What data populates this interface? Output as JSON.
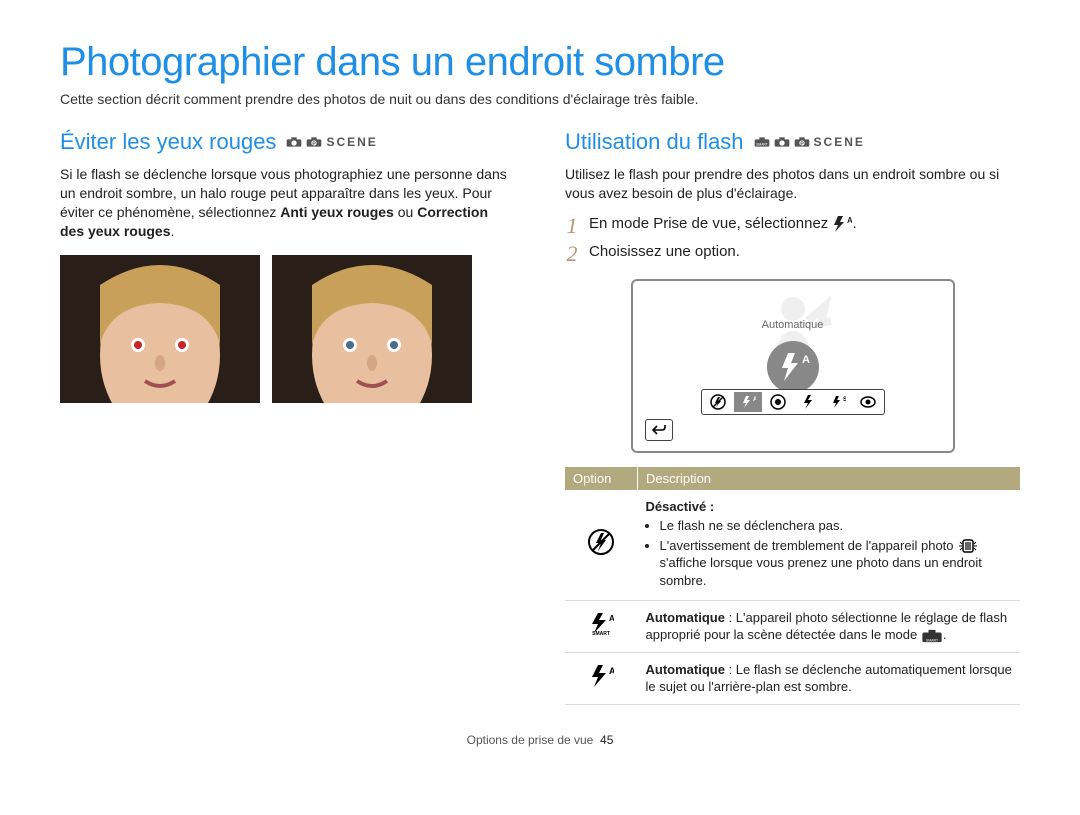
{
  "title": "Photographier dans un endroit sombre",
  "intro": "Cette section décrit comment prendre des photos de nuit ou dans des conditions d'éclairage très faible.",
  "left": {
    "heading": "Éviter les yeux rouges",
    "body_plain": "Si le flash se déclenche lorsque vous photographiez une personne dans un endroit sombre, un halo rouge peut apparaître dans les yeux. Pour éviter ce phénomène, sélectionnez ",
    "body_bold": "Anti yeux rouges",
    "body_join": " ou ",
    "body_bold2": "Correction des yeux rouges",
    "body_end": "."
  },
  "right": {
    "heading": "Utilisation du flash",
    "body": "Utilisez le flash pour prendre des photos dans un endroit sombre ou si vous avez besoin de plus d'éclairage.",
    "steps": [
      "En mode Prise de vue, sélectionnez ",
      "Choisissez une option."
    ],
    "step1_tail": "."
  },
  "screen": {
    "mode_label": "Automatique"
  },
  "table_header": {
    "option": "Option",
    "desc": "Description"
  },
  "rows": {
    "off": {
      "title": "Désactivé :",
      "b1": "Le flash ne se déclenchera pas.",
      "b2_pre": "L'avertissement de tremblement de l'appareil photo",
      "b2_post": " s'affiche lorsque vous prenez une photo dans un endroit sombre."
    },
    "auto_smart": {
      "title": "Automatique",
      "text_pre": " : L'appareil photo sélectionne le réglage de flash approprié pour la scène détectée dans le mode ",
      "text_post": "."
    },
    "auto_std": {
      "title": "Automatique",
      "text": " : Le flash se déclenche automatiquement lorsque le sujet ou l'arrière-plan est sombre."
    }
  },
  "footer": {
    "section": "Options de prise de vue",
    "page": "45"
  }
}
